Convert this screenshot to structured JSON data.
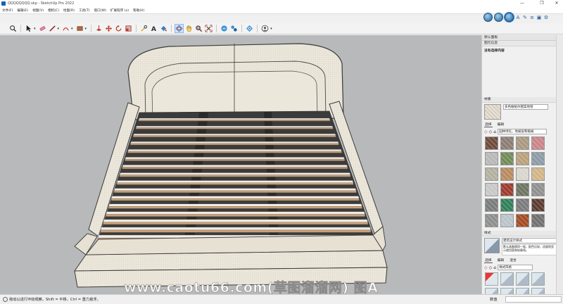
{
  "window": {
    "title": "QQQQQQQQ.skp - SketchUp Pro 2022",
    "controls": {
      "minimize": "—",
      "maximize": "❐",
      "close": "✕"
    }
  },
  "menu": {
    "items": [
      "文件(F)",
      "编辑(E)",
      "视图(V)",
      "相机(C)",
      "绘图(R)",
      "工具(T)",
      "窗口(W)",
      "扩展程序 (x)",
      "帮助(H)"
    ]
  },
  "toolbar": {
    "icons": [
      "zoom-icon",
      "select-arrow-icon",
      "eraser-icon",
      "pencil-icon",
      "arc-icon",
      "rectangle-icon",
      "push-pull-icon",
      "move-icon",
      "rotate-icon",
      "scale-icon",
      "tape-measure-icon",
      "text-icon",
      "paint-bucket-icon",
      "orbit-icon",
      "pan-icon",
      "zoom-window-icon",
      "zoom-extents-icon",
      "warehouse-icon",
      "extension-icon",
      "layout-icon",
      "account-icon"
    ]
  },
  "status": {
    "text": "拖动以进行环绕观察。Shift = 平移，Ctrl = 重力悬浮。",
    "measurements_label": "数值"
  },
  "watermark": "www.caotu66.com(草图溜溜网) 图A",
  "tray": {
    "title": "默认面板",
    "entity_info": {
      "header": "图元信息",
      "body": "没有选择内容"
    },
    "materials": {
      "header": "材质",
      "current_name": "多色柏帕尔图案地毯",
      "tabs": [
        "选择",
        "编辑"
      ],
      "library": "园林绿化，地被层和植被",
      "swatch_colors": [
        "#6e4a3a",
        "#8b7b72",
        "#a99780",
        "#c98489",
        "#b7b7b7",
        "#6f8a56",
        "#b8a07a",
        "#8a9aa5",
        "#b1b09e",
        "#b88a5e",
        "#d8d5cc",
        "#d1b486",
        "#c7c7c7",
        "#9c3a2c",
        "#6c7460",
        "#8f8f8f",
        "#777c7a",
        "#2e7f57",
        "#7a7a7a",
        "#5a3a2e",
        "#8d8d8d",
        "#b9c3c8",
        "#a34a22",
        "#6f6f6f"
      ]
    },
    "styles": {
      "header": "样式",
      "name": "建筑设计样式",
      "description": "默认具备随同一般，配色比较，适度地显示使用面和轮廓线。",
      "tabs": [
        "选择",
        "编辑",
        "混合"
      ],
      "library": "样式风格"
    }
  },
  "colors": {
    "viewport_bg": "#b8b9ba",
    "bed_fabric": "#ebe6da",
    "slat_top": "#f1eee8",
    "slat_wood": "#c8a27c",
    "accent_blue": "#2a7fd4"
  }
}
